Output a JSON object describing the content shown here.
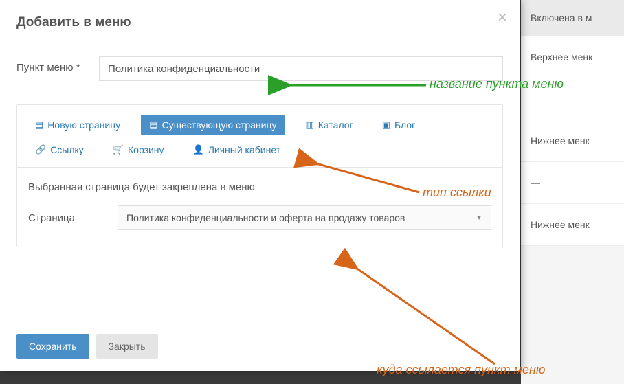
{
  "modal": {
    "title": "Добавить в меню",
    "close_glyph": "×",
    "field_label": "Пункт меню *",
    "field_value": "Политика конфиденциальности",
    "tabs": {
      "new_page": "Новую страницу",
      "existing_page": "Существующую страницу",
      "catalog": "Каталог",
      "blog": "Блог",
      "link": "Ссылку",
      "cart": "Корзину",
      "account": "Личный кабинет"
    },
    "section_text": "Выбранная страница будет закреплена в меню",
    "select_label": "Страница",
    "select_value": "Политика конфиденциальности и оферта на продажу товаров",
    "save": "Сохранить",
    "cancel": "Закрыть"
  },
  "annotations": {
    "name_hint": "название пункта меню",
    "type_hint": "тип ссылки",
    "target_hint": "куда ссылается пункт меню"
  },
  "bg": {
    "col_header": "Включена в м",
    "row1": "Верхнее менк",
    "row2_dash": "—",
    "row3": "Нижнее менк",
    "row4_dash": "—",
    "row5": "Нижнее менк"
  }
}
